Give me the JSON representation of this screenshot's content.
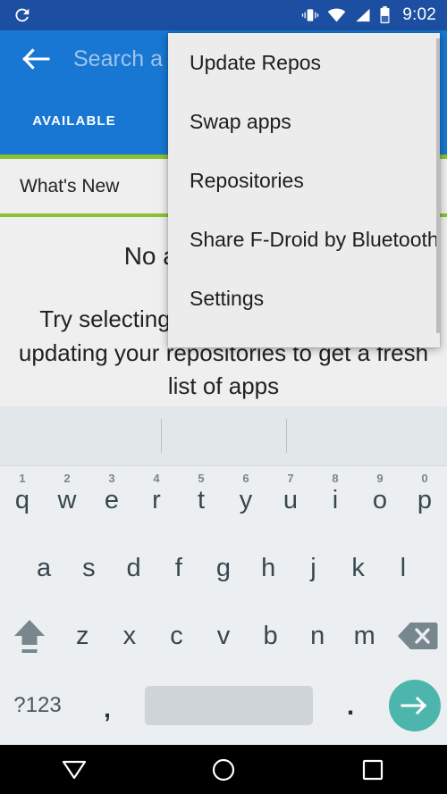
{
  "status_bar": {
    "refresh_icon": "refresh-icon",
    "vibrate_icon": "vibrate-icon",
    "wifi_icon": "wifi-icon",
    "signal_icon": "cell-signal-icon",
    "battery_icon": "battery-icon",
    "time": "9:02"
  },
  "app_bar": {
    "back_icon": "back-arrow-icon",
    "search_placeholder": "Search a"
  },
  "tabs": [
    {
      "label": "AVAILABLE",
      "selected": true
    }
  ],
  "content": {
    "section_header": "What's New",
    "empty_title": "No apps available",
    "empty_body": "Try selecting a different category, or updating your repositories to get a fresh list of apps"
  },
  "popup_menu": {
    "items": [
      {
        "label": "Update Repos"
      },
      {
        "label": "Swap apps"
      },
      {
        "label": "Repositories"
      },
      {
        "label": "Share F-Droid by Bluetooth"
      },
      {
        "label": "Settings"
      }
    ]
  },
  "keyboard": {
    "row1": [
      {
        "key": "q",
        "num": "1"
      },
      {
        "key": "w",
        "num": "2"
      },
      {
        "key": "e",
        "num": "3"
      },
      {
        "key": "r",
        "num": "4"
      },
      {
        "key": "t",
        "num": "5"
      },
      {
        "key": "y",
        "num": "6"
      },
      {
        "key": "u",
        "num": "7"
      },
      {
        "key": "i",
        "num": "8"
      },
      {
        "key": "o",
        "num": "9"
      },
      {
        "key": "p",
        "num": "0"
      }
    ],
    "row2": [
      {
        "key": "a"
      },
      {
        "key": "s"
      },
      {
        "key": "d"
      },
      {
        "key": "f"
      },
      {
        "key": "g"
      },
      {
        "key": "h"
      },
      {
        "key": "j"
      },
      {
        "key": "k"
      },
      {
        "key": "l"
      }
    ],
    "row3": [
      {
        "key": "z"
      },
      {
        "key": "x"
      },
      {
        "key": "c"
      },
      {
        "key": "v"
      },
      {
        "key": "b"
      },
      {
        "key": "n"
      },
      {
        "key": "m"
      }
    ],
    "shift_icon": "shift-icon",
    "backspace_icon": "backspace-icon",
    "symbols_label": "?123",
    "comma_label": ",",
    "period_label": ".",
    "space_label": "",
    "enter_icon": "enter-arrow-icon"
  },
  "nav_bar": {
    "back_icon": "nav-back-icon",
    "home_icon": "nav-home-icon",
    "recents_icon": "nav-recents-icon"
  },
  "colors": {
    "status_bar": "#1c4fa1",
    "app_bar": "#1877d2",
    "accent_green": "#8cc133",
    "content_bg": "#efefef",
    "menu_bg": "#ececec",
    "keyboard_bg": "#eceff1",
    "enter_key": "#4db6ac",
    "nav_bar": "#000000"
  }
}
